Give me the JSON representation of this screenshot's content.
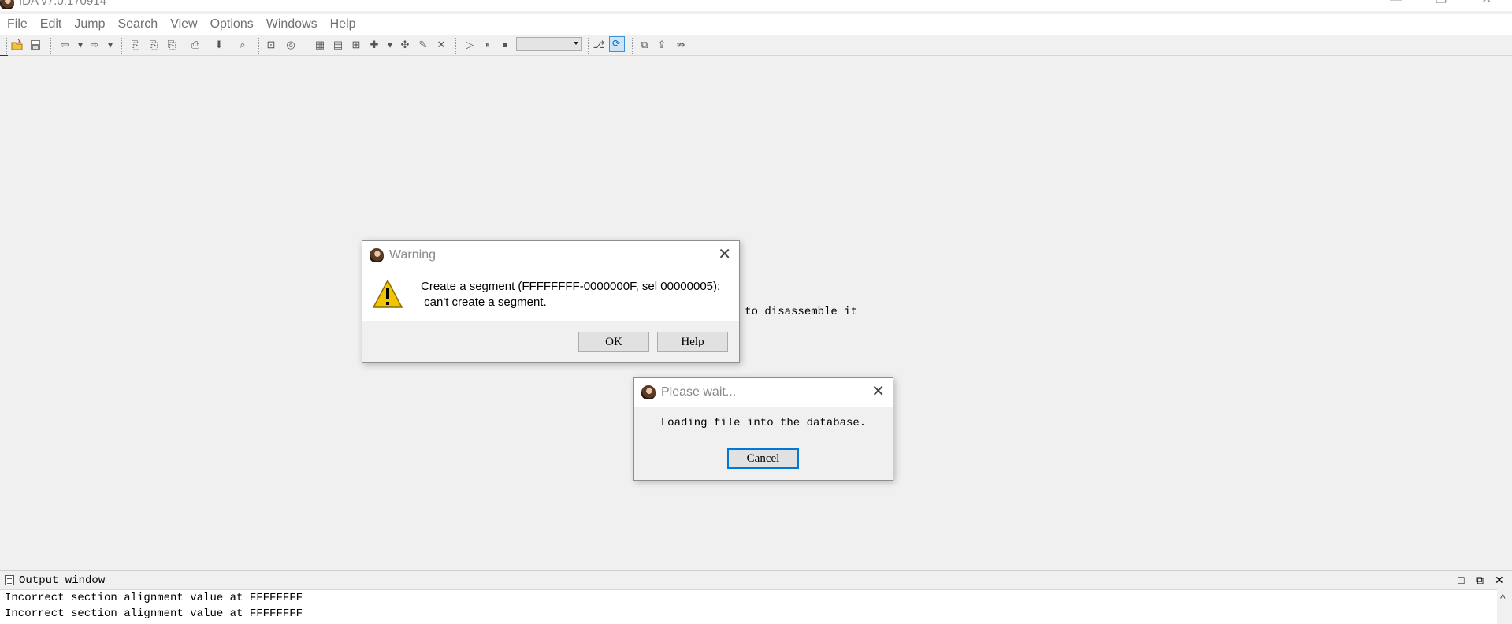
{
  "window": {
    "title": "IDA v7.0.170914",
    "controls": {
      "minimize": "—",
      "restore": "❐",
      "close": "✕"
    }
  },
  "menu": [
    "File",
    "Edit",
    "Jump",
    "Search",
    "View",
    "Options",
    "Windows",
    "Help"
  ],
  "background_text": "re to disassemble it",
  "warning_dialog": {
    "title": "Warning",
    "message_line1": "Create a segment (FFFFFFFF-0000000F, sel 00000005):",
    "message_line2": " can't create a segment.",
    "ok_label": "OK",
    "help_label": "Help",
    "close": "✕"
  },
  "wait_dialog": {
    "title": "Please wait...",
    "message": "Loading file into the database.",
    "cancel_label": "Cancel",
    "close": "✕"
  },
  "output_window": {
    "title": "Output window",
    "lines": [
      "Incorrect section alignment value at FFFFFFFF",
      "Incorrect section alignment value at FFFFFFFF"
    ],
    "controls": {
      "maximize": "□",
      "float": "⧉",
      "close": "✕"
    },
    "scroll_up": "^"
  },
  "colors": {
    "accent": "#0078d7",
    "active_toolbar": "#cce4f7",
    "warning_yellow": "#f5c400"
  }
}
